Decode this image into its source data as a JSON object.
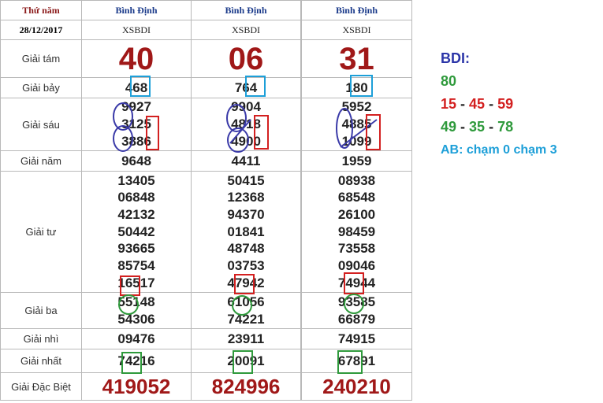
{
  "table": {
    "header": {
      "label": "Thứ năm",
      "provinces": [
        "Bình Định",
        "Bình Định",
        "Bình Định"
      ]
    },
    "date_label": "28/12/2017",
    "codes": [
      "XSBDI",
      "XSBDI",
      "XSBDI"
    ],
    "prize_labels": {
      "g8": "Giải tám",
      "g7": "Giải bảy",
      "g6": "Giải sáu",
      "g5": "Giải năm",
      "g4": "Giải tư",
      "g3": "Giải ba",
      "g2": "Giải nhì",
      "g1": "Giải nhất",
      "db": "Giải Đặc Biệt"
    },
    "columns": [
      {
        "g8": "40",
        "g7": "468",
        "g6": [
          "9927",
          "3125",
          "3886"
        ],
        "g5": "9648",
        "g4": [
          "13405",
          "06848",
          "42132",
          "50442",
          "93665",
          "85754",
          "16517"
        ],
        "g3": [
          "55148",
          "54306"
        ],
        "g2": "09476",
        "g1": "74216",
        "db": "419052"
      },
      {
        "g8": "06",
        "g7": "764",
        "g6": [
          "9904",
          "4818",
          "4900"
        ],
        "g5": "4411",
        "g4": [
          "50415",
          "12368",
          "94370",
          "01841",
          "48748",
          "03753",
          "47942"
        ],
        "g3": [
          "61056",
          "74221"
        ],
        "g2": "23911",
        "g1": "20091",
        "db": "824996"
      },
      {
        "g8": "31",
        "g7": "180",
        "g6": [
          "5952",
          "4885",
          "1099"
        ],
        "g5": "1959",
        "g4": [
          "08938",
          "68548",
          "26100",
          "98459",
          "73558",
          "09046",
          "74944"
        ],
        "g3": [
          "93585",
          "66879"
        ],
        "g2": "74915",
        "g1": "67891",
        "db": "240210"
      }
    ]
  },
  "prediction": {
    "title": "BDI:",
    "line1": "80",
    "line2": [
      "15",
      "45",
      "59"
    ],
    "line3": [
      "49",
      "35",
      "78"
    ],
    "separator": " - ",
    "line4": "AB: chạm 0 chạm 3"
  },
  "colors": {
    "blue": "#2b35a8",
    "green": "#2f9a3c",
    "red": "#d32020",
    "cyan": "#1d9fd8",
    "prize_red": "#a01818"
  }
}
